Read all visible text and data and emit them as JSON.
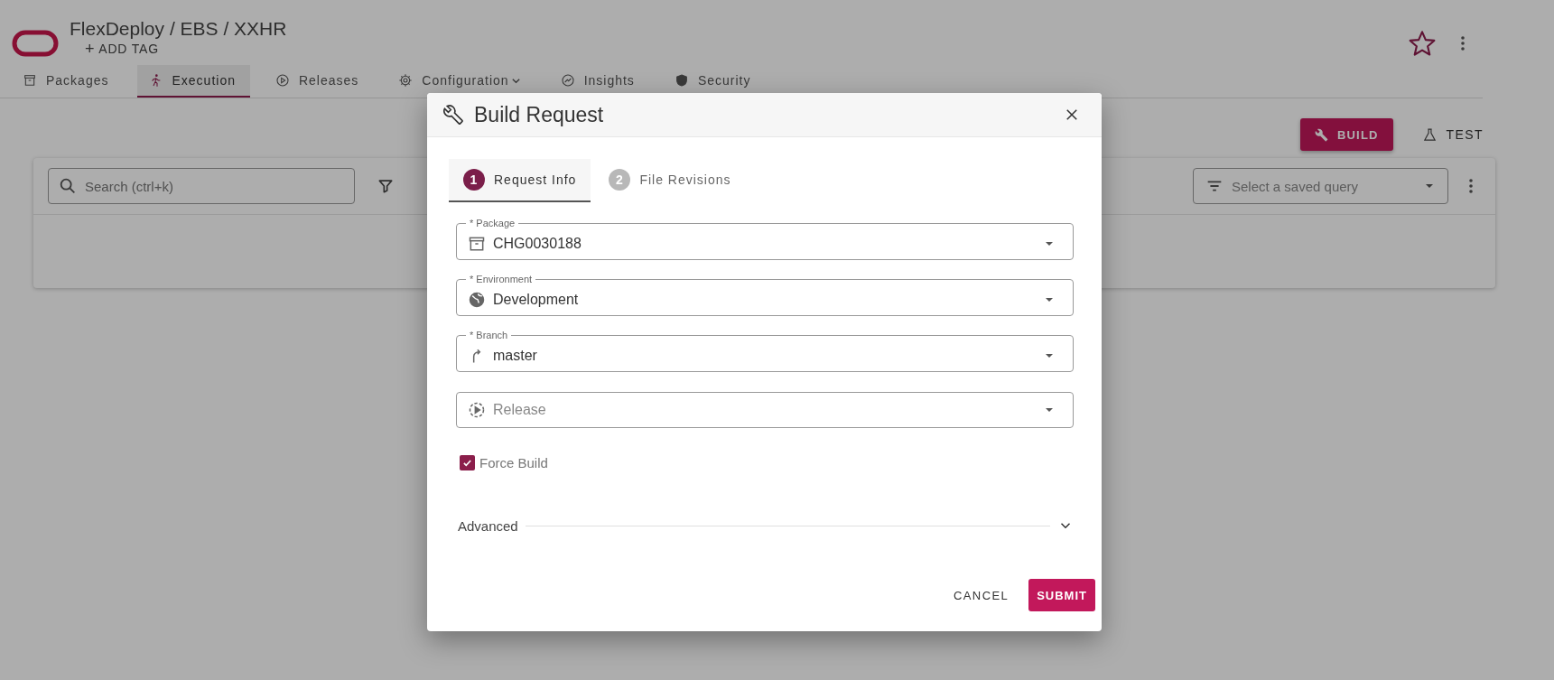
{
  "header": {
    "breadcrumb": "FlexDeploy / EBS / XXHR",
    "add_tag": "ADD TAG",
    "add_tag_icon": "+"
  },
  "tabs": [
    {
      "label": "Packages",
      "kind": "package",
      "selected": false,
      "dropdown": false
    },
    {
      "label": "Execution",
      "kind": "execution",
      "selected": true,
      "dropdown": false
    },
    {
      "label": "Releases",
      "kind": "release",
      "selected": false,
      "dropdown": false
    },
    {
      "label": "Configuration",
      "kind": "gear",
      "selected": false,
      "dropdown": true
    },
    {
      "label": "Insights",
      "kind": "insights",
      "selected": false,
      "dropdown": false
    },
    {
      "label": "Security",
      "kind": "security",
      "selected": false,
      "dropdown": false
    }
  ],
  "actions": {
    "build": "BUILD",
    "test": "TEST"
  },
  "toolbar": {
    "search": {
      "placeholder": "Search (ctrl+k)"
    },
    "saved_query": {
      "placeholder": "Select a saved query"
    }
  },
  "dialog": {
    "title": "Build Request",
    "steps": [
      {
        "number": "1",
        "label": "Request Info",
        "selected": true
      },
      {
        "number": "2",
        "label": "File Revisions",
        "selected": false
      }
    ],
    "fields": [
      {
        "kind": "package",
        "label": "* Package",
        "value": "CHG0030188"
      },
      {
        "kind": "environment",
        "label": "* Environment",
        "value": "Development"
      },
      {
        "kind": "branch",
        "label": "* Branch",
        "value": "master"
      },
      {
        "kind": "release",
        "placeholder": "Release"
      }
    ],
    "force_build": {
      "label": "Force Build",
      "checked": true
    },
    "advanced": {
      "label": "Advanced",
      "expanded": false
    },
    "buttons": {
      "cancel": "CANCEL",
      "submit": "SUBMIT"
    }
  }
}
